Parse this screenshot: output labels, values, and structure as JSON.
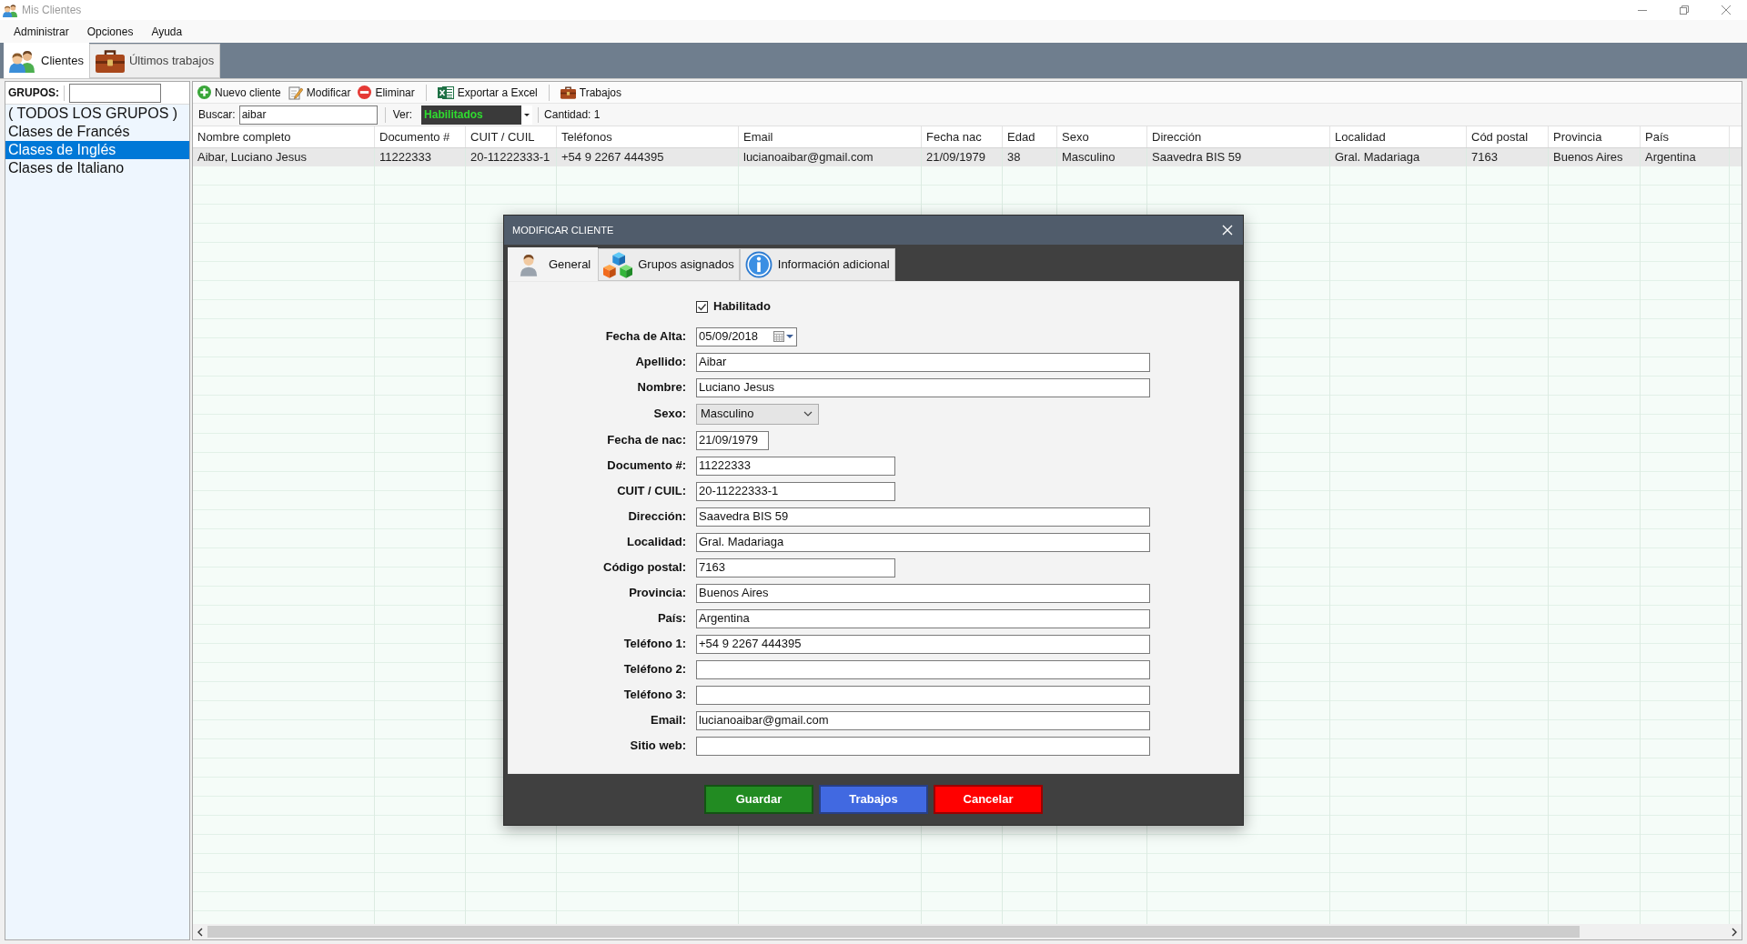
{
  "window": {
    "title": "Mis Clientes"
  },
  "menu": [
    {
      "label": "Administrar"
    },
    {
      "label": "Opciones"
    },
    {
      "label": "Ayuda"
    }
  ],
  "main_tabs": [
    {
      "label": "Clientes",
      "kind": "people",
      "selected": true
    },
    {
      "label": "Últimos trabajos",
      "kind": "briefcase",
      "selected": false
    }
  ],
  "groups": {
    "label": "GRUPOS:",
    "items": [
      {
        "label": "( TODOS LOS GRUPOS )",
        "selected": false
      },
      {
        "label": "Clases de Francés",
        "selected": false
      },
      {
        "label": "Clases de Inglés",
        "selected": true
      },
      {
        "label": "Clases de Italiano",
        "selected": false
      }
    ]
  },
  "toolbar": [
    {
      "buttons": [
        {
          "label": "Nuevo cliente",
          "kind": "add"
        },
        {
          "label": "Modificar",
          "kind": "edit"
        },
        {
          "label": "Eliminar",
          "kind": "delete"
        }
      ]
    },
    {
      "buttons": [
        {
          "label": "Exportar a Excel",
          "kind": "excel"
        }
      ]
    },
    {
      "buttons": [
        {
          "label": "Trabajos",
          "kind": "briefcase"
        }
      ]
    }
  ],
  "search": {
    "label": "Buscar:",
    "value": "aibar"
  },
  "view_filter": {
    "label": "Ver:",
    "value": "Habilitados"
  },
  "count": "Cantidad: 1",
  "table": {
    "columns": [
      "Nombre completo",
      "Documento #",
      "CUIT / CUIL",
      "Teléfonos",
      "Email",
      "Fecha nac",
      "Edad",
      "Sexo",
      "Dirección",
      "Localidad",
      "Cód postal",
      "Provincia",
      "País"
    ],
    "rows": [
      {
        "selected": true,
        "cells": [
          "Aibar, Luciano Jesus",
          "11222333",
          "20-11222333-1",
          "+54 9 2267 444395",
          "lucianoaibar@gmail.com",
          "21/09/1979",
          "38",
          "Masculino",
          "Saavedra BIS 59",
          "Gral. Madariaga",
          "7163",
          "Buenos Aires",
          "Argentina"
        ]
      }
    ]
  },
  "dialog": {
    "title": "MODIFICAR CLIENTE",
    "tabs": [
      {
        "label": "General",
        "kind": "person",
        "selected": true
      },
      {
        "label": "Grupos asignados",
        "kind": "cubes",
        "selected": false
      },
      {
        "label": "Información adicional",
        "kind": "info",
        "selected": false
      }
    ],
    "enabled": {
      "label": "Habilitado",
      "checked": true
    },
    "fields": [
      {
        "label": "Fecha de Alta:",
        "value": "05/09/2018",
        "kind": "datepicker"
      },
      {
        "label": "Apellido:",
        "value": "Aibar",
        "kind": "long"
      },
      {
        "label": "Nombre:",
        "value": "Luciano Jesus",
        "kind": "long"
      },
      {
        "label": "Sexo:",
        "value": "Masculino",
        "kind": "dropdown"
      },
      {
        "label": "Fecha de nac:",
        "value": "21/09/1979",
        "kind": "date"
      },
      {
        "label": "Documento #:",
        "value": "11222333",
        "kind": "short"
      },
      {
        "label": "CUIT / CUIL:",
        "value": "20-11222333-1",
        "kind": "short"
      },
      {
        "label": "Dirección:",
        "value": "Saavedra BIS 59",
        "kind": "long"
      },
      {
        "label": "Localidad:",
        "value": "Gral. Madariaga",
        "kind": "long"
      },
      {
        "label": "Código postal:",
        "value": "7163",
        "kind": "short"
      },
      {
        "label": "Provincia:",
        "value": "Buenos Aires",
        "kind": "long"
      },
      {
        "label": "País:",
        "value": "Argentina",
        "kind": "long"
      },
      {
        "label": "Teléfono 1:",
        "value": "+54 9 2267 444395",
        "kind": "long"
      },
      {
        "label": "Teléfono 2:",
        "kind": "long"
      },
      {
        "label": "Teléfono 3:",
        "kind": "long"
      },
      {
        "label": "Email:",
        "value": "lucianoaibar@gmail.com",
        "kind": "long"
      },
      {
        "label": "Sitio web:",
        "kind": "long"
      }
    ],
    "buttons": [
      {
        "label": "Guardar",
        "color": "#228b22"
      },
      {
        "label": "Trabajos",
        "color": "#4169e1"
      },
      {
        "label": "Cancelar",
        "color": "#ff0000"
      }
    ]
  }
}
